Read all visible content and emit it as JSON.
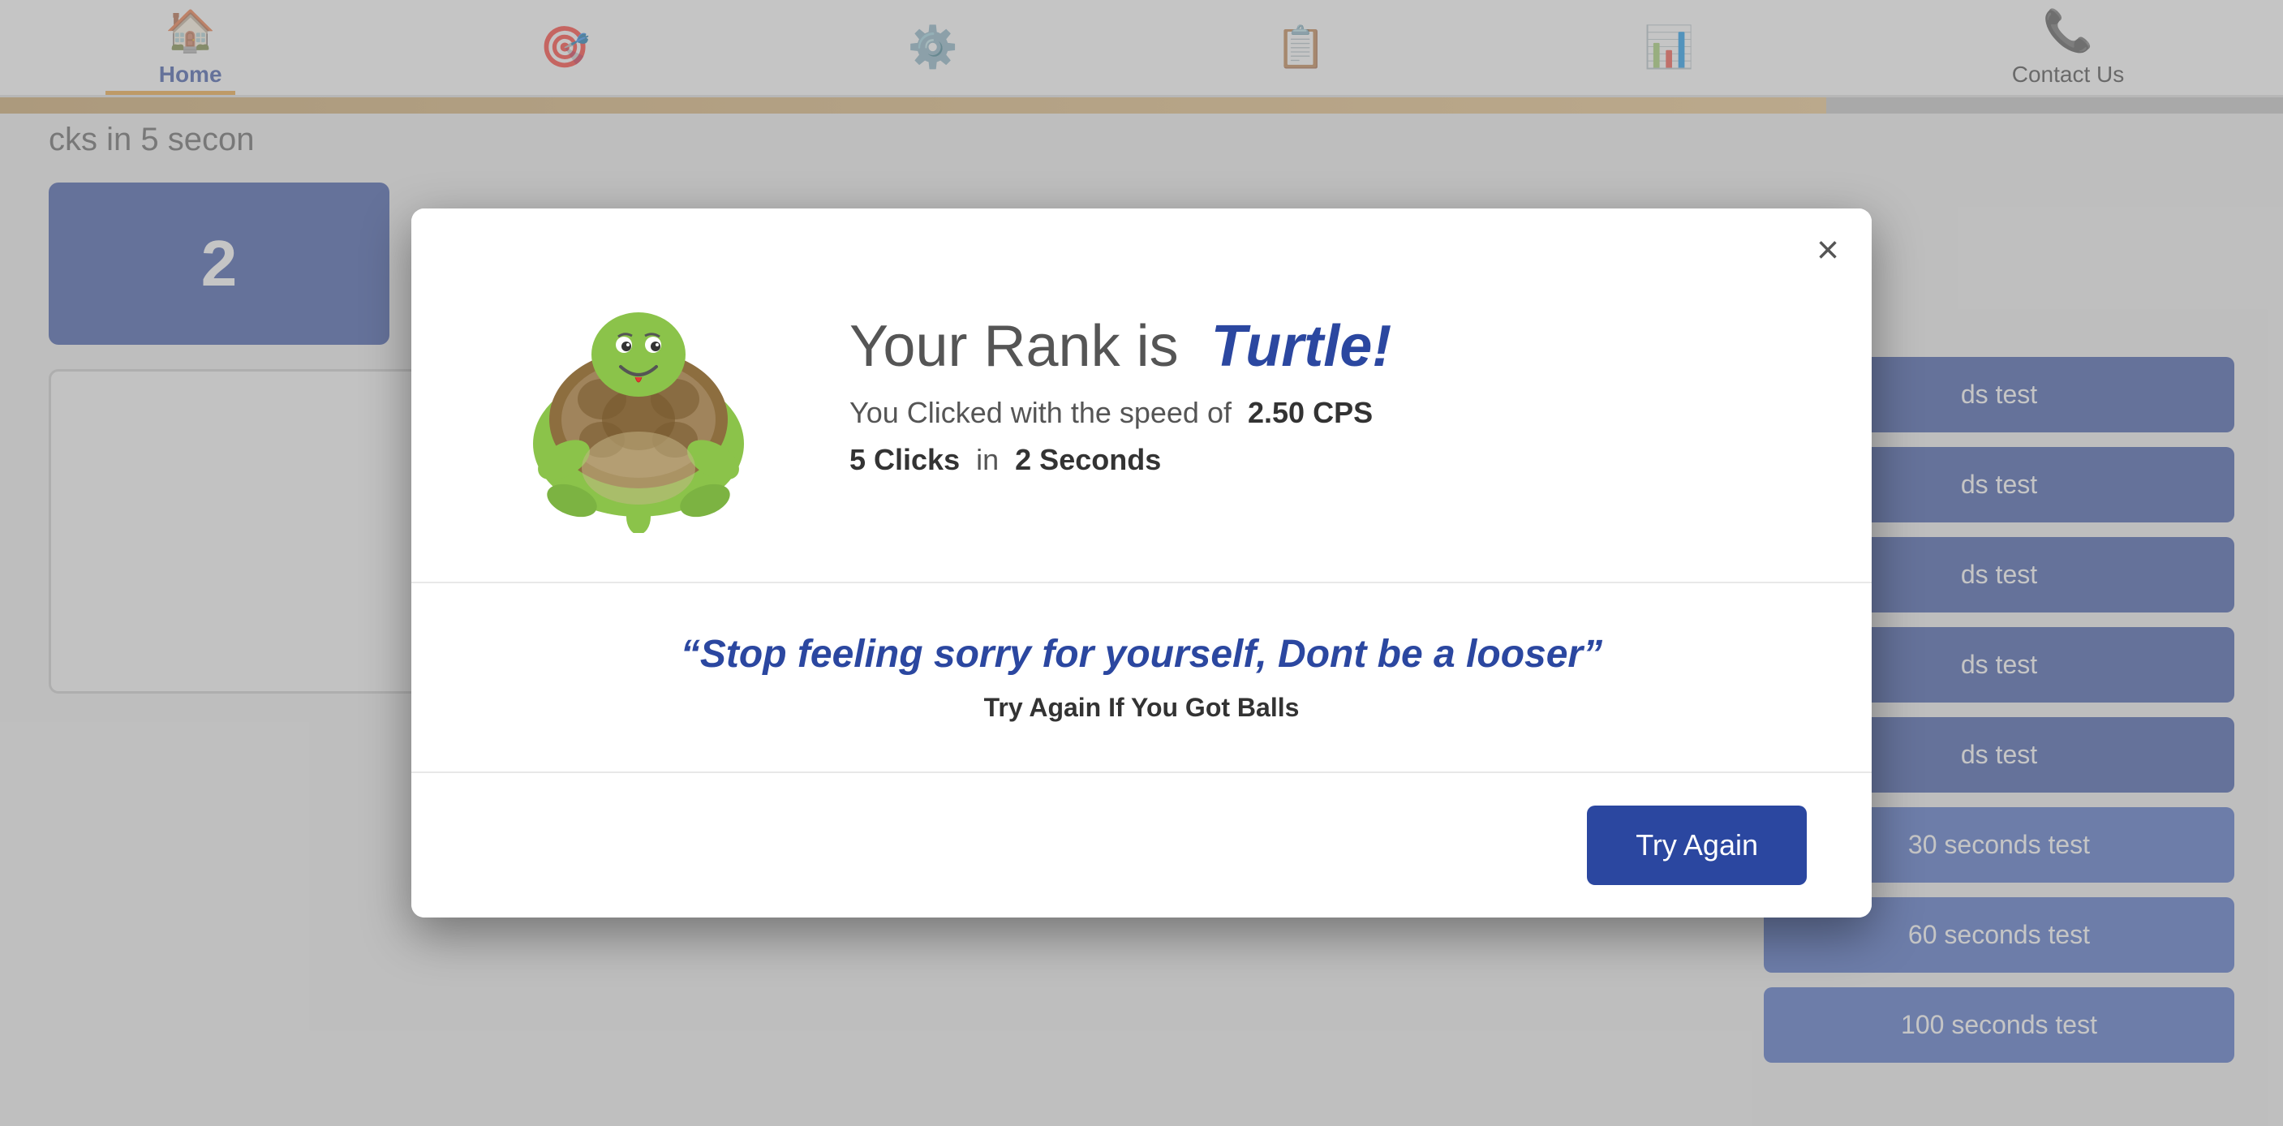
{
  "header": {
    "nav_items": [
      {
        "label": "Home",
        "icon": "🏠",
        "active": true
      },
      {
        "label": "",
        "icon": "🎮",
        "active": false
      },
      {
        "label": "",
        "icon": "⚙️",
        "active": false
      },
      {
        "label": "",
        "icon": "📋",
        "active": false
      },
      {
        "label": "",
        "icon": "📊",
        "active": false
      },
      {
        "label": "Contact Us",
        "icon": "📞",
        "active": false
      }
    ]
  },
  "background": {
    "content_title": "cks in 5 secon",
    "click_number": "2",
    "sidebar_buttons": [
      {
        "label": "ds test"
      },
      {
        "label": "ds test"
      },
      {
        "label": "ds test"
      },
      {
        "label": "ds test"
      },
      {
        "label": "ds test"
      },
      {
        "label": "30 seconds test"
      },
      {
        "label": "60 seconds test"
      },
      {
        "label": "100 seconds test"
      }
    ]
  },
  "modal": {
    "close_label": "×",
    "rank_prefix": "Your Rank is",
    "rank_value": "Turtle!",
    "cps_prefix": "You Clicked with the speed of",
    "cps_value": "2.50 CPS",
    "clicks_label": "5 Clicks",
    "clicks_mid": "in",
    "seconds_label": "2 Seconds",
    "quote": "“Stop feeling sorry for yourself, Dont be a looser”",
    "sub_quote": "Try Again If You Got Balls",
    "try_again_label": "Try Again"
  }
}
